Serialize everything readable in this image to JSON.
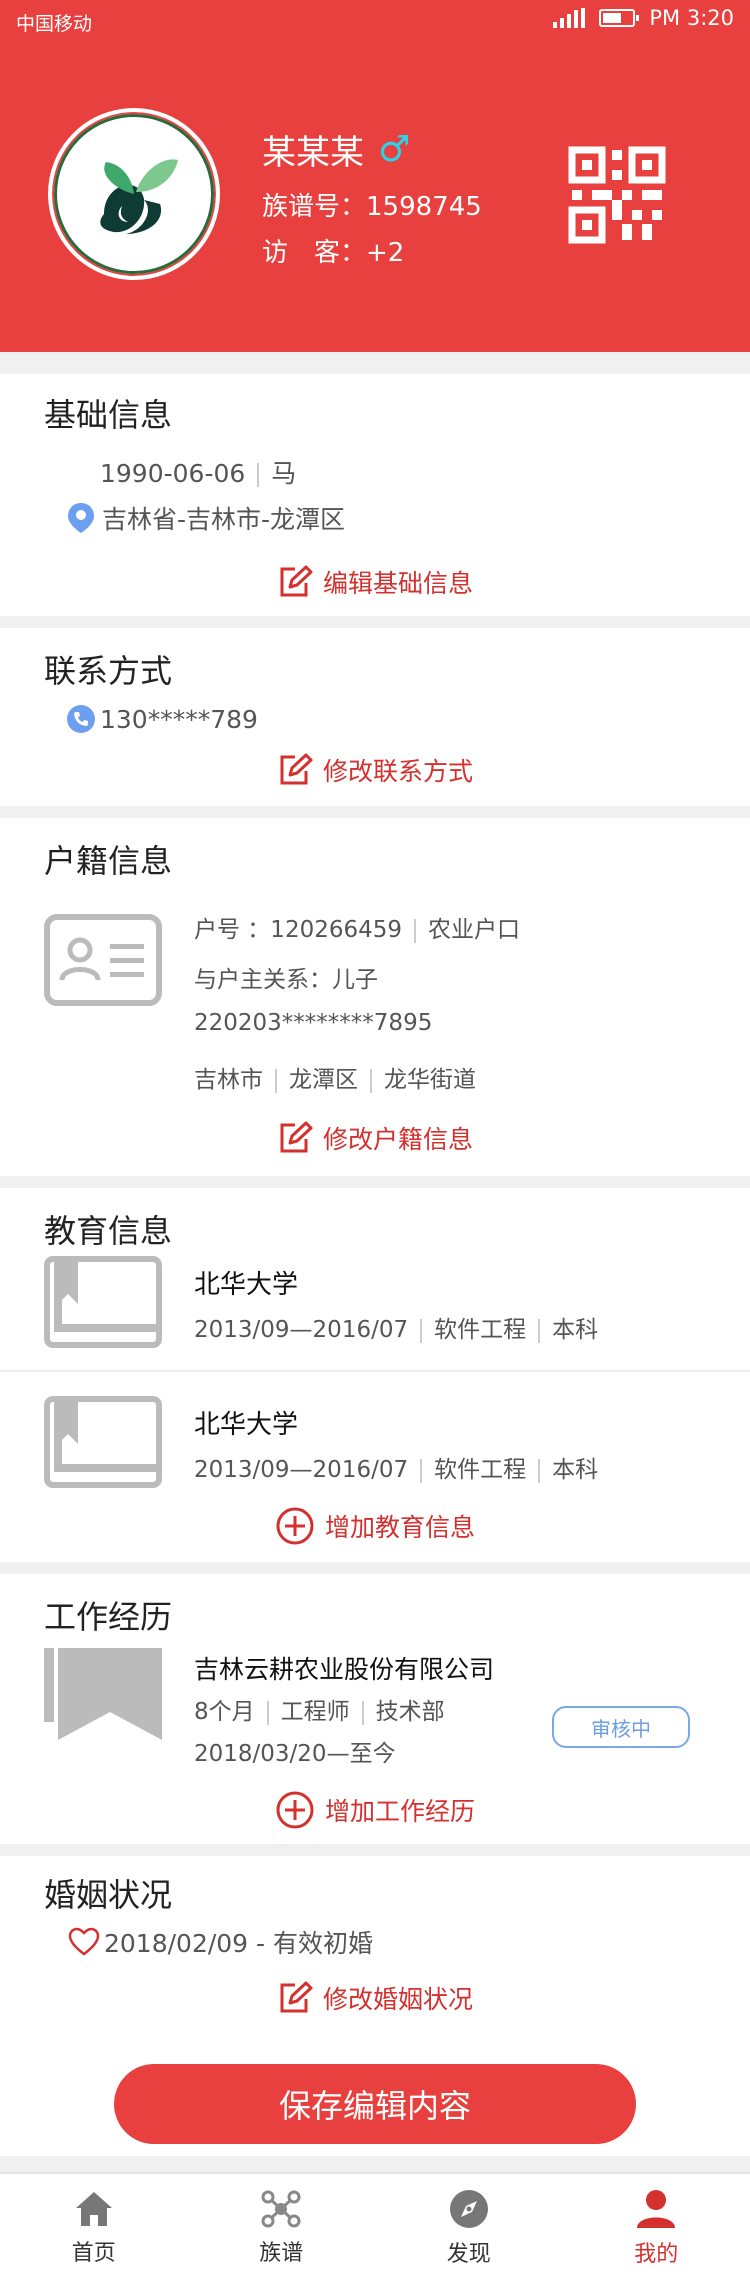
{
  "status_bar": {
    "carrier": "中国移动",
    "time": "PM 3:20"
  },
  "profile": {
    "name": "某某某",
    "gender_symbol": "♂",
    "clan_no": "族谱号：1598745",
    "visitor": "访　客：+2"
  },
  "basic_info": {
    "title": "基础信息",
    "birthday": "1990-06-06",
    "zodiac": "马",
    "location": "吉林省-吉林市-龙潭区",
    "action": "编辑基础信息"
  },
  "contact": {
    "title": "联系方式",
    "phone": "130*****789",
    "action": "修改联系方式"
  },
  "household": {
    "title": "户籍信息",
    "hukou_no": "户号 ：120266459",
    "hukou_type": "农业户口",
    "relation": "与户主关系：儿子",
    "id_no": "220203********7895",
    "city": "吉林市",
    "district": "龙潭区",
    "street": "龙华街道",
    "action": "修改户籍信息"
  },
  "education": {
    "title": "教育信息",
    "items": [
      {
        "school": "北华大学",
        "period": "2013/09—2016/07",
        "major": "软件工程",
        "degree": "本科"
      },
      {
        "school": "北华大学",
        "period": "2013/09—2016/07",
        "major": "软件工程",
        "degree": "本科"
      }
    ],
    "action": "增加教育信息"
  },
  "work": {
    "title": "工作经历",
    "company": "吉林云耕农业股份有限公司",
    "duration": "8个月",
    "position": "工程师",
    "department": "技术部",
    "period": "2018/03/20—至今",
    "status": "审核中",
    "action": "增加工作经历"
  },
  "marriage": {
    "title": "婚姻状况",
    "record": "2018/02/09 - 有效初婚",
    "action": "修改婚姻状况"
  },
  "save_label": "保存编辑内容",
  "tabs": [
    {
      "label": "首页",
      "icon": "home-icon"
    },
    {
      "label": "族谱",
      "icon": "family-tree-icon"
    },
    {
      "label": "发现",
      "icon": "compass-icon"
    },
    {
      "label": "我的",
      "icon": "user-icon"
    }
  ],
  "colors": {
    "brand_red": "#e8403f",
    "action_red": "#d3302e",
    "badge_blue": "#6f9ee0"
  }
}
